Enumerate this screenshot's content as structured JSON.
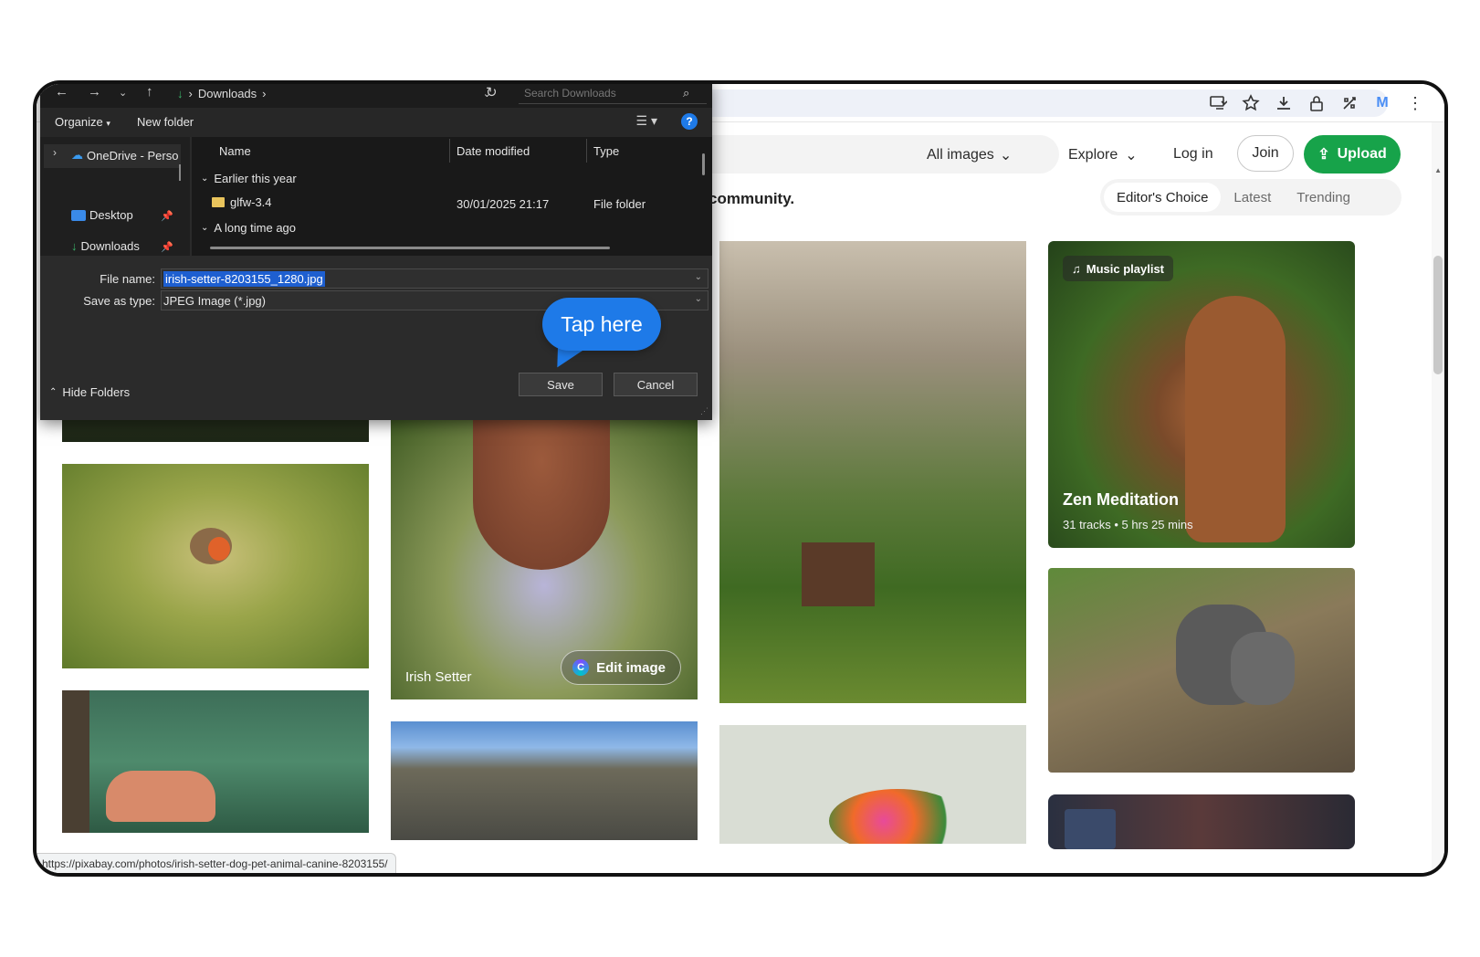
{
  "browser": {
    "icons": [
      "install-app-icon",
      "star-icon",
      "download-icon",
      "lock-icon",
      "extensions-icon"
    ],
    "profile_initial": "M",
    "status_url": "https://pixabay.com/photos/irish-setter-dog-pet-animal-canine-8203155/"
  },
  "site_nav": {
    "filter_label": "All images",
    "explore_label": "Explore",
    "login_label": "Log in",
    "join_label": "Join",
    "upload_label": "Upload",
    "brand_color": "#17a34a"
  },
  "gallery": {
    "tagline_fragment": "community.",
    "sort_tabs": [
      {
        "label": "Editor's Choice",
        "active": true
      },
      {
        "label": "Latest",
        "active": false
      },
      {
        "label": "Trending",
        "active": false
      }
    ],
    "featured": {
      "caption": "Irish Setter",
      "edit_label": "Edit image"
    },
    "playlist": {
      "badge": "Music playlist",
      "title": "Zen Meditation",
      "tracks": "31 tracks",
      "duration": "5 hrs 25 mins"
    }
  },
  "dialog": {
    "path_folder": "Downloads",
    "search_placeholder": "Search Downloads",
    "organize_label": "Organize",
    "new_folder_label": "New folder",
    "help_label": "?",
    "nav_items": [
      {
        "label": "OneDrive - Perso"
      },
      {
        "label": "Desktop"
      },
      {
        "label": "Downloads"
      }
    ],
    "columns": {
      "name": "Name",
      "date": "Date modified",
      "type": "Type"
    },
    "groups": {
      "this_year": "Earlier this year",
      "long_ago": "A long time ago"
    },
    "rows": [
      {
        "name": "glfw-3.4",
        "date": "30/01/2025 21:17",
        "type": "File folder"
      }
    ],
    "file_name_label": "File name:",
    "file_name_value": "irish-setter-8203155_1280.jpg",
    "save_type_label": "Save as type:",
    "save_type_value": "JPEG Image (*.jpg)",
    "save_label": "Save",
    "cancel_label": "Cancel",
    "hide_folders_label": "Hide Folders",
    "accent_color": "#1e7ae8"
  },
  "tooltip": {
    "text": "Tap here"
  }
}
